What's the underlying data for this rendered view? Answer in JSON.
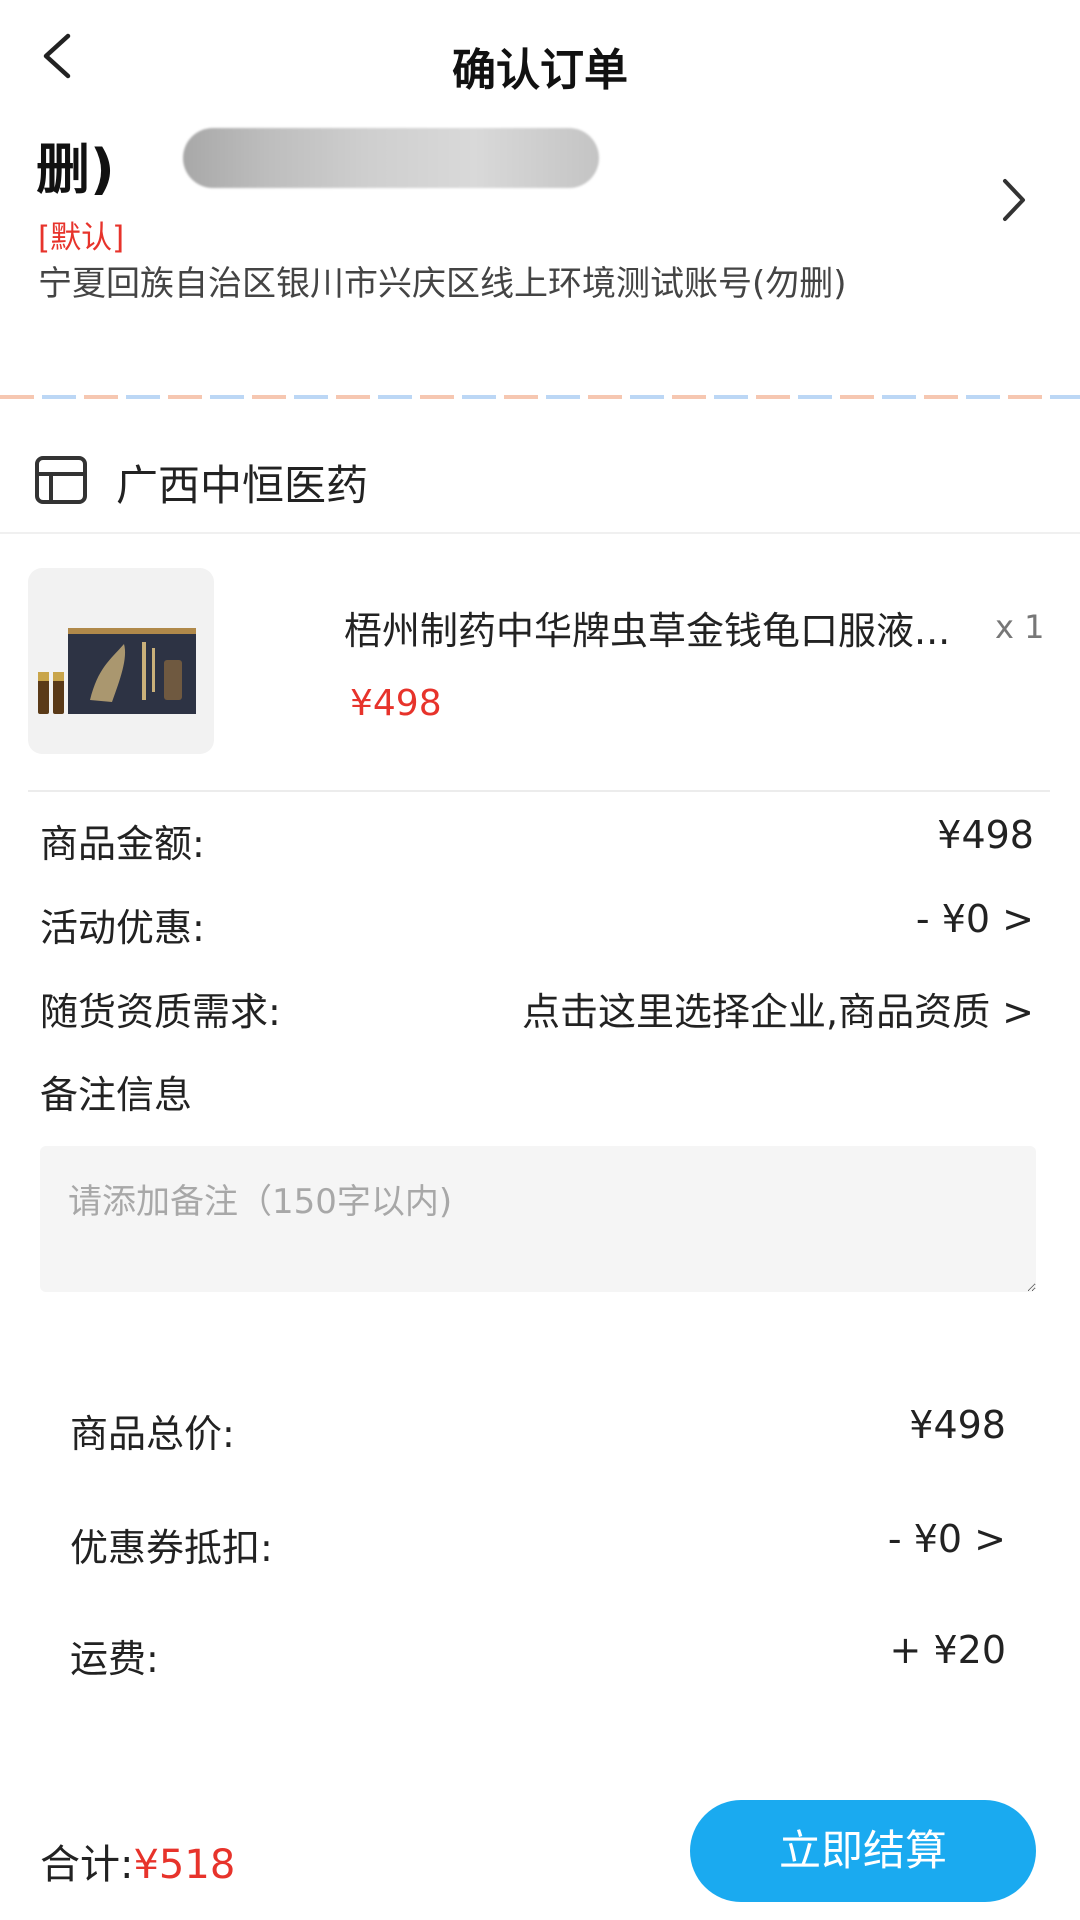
{
  "header": {
    "title": "确认订单"
  },
  "address": {
    "name": "删)",
    "default_tag": "[默认]",
    "text": "宁夏回族自治区银川市兴庆区线上环境测试账号(勿删)"
  },
  "store": {
    "name": "广西中恒医药",
    "icon": "store-icon"
  },
  "product": {
    "name": "梧州制药中华牌虫草金钱龟口服液...",
    "quantity": "x 1",
    "price": "¥498"
  },
  "summary": {
    "goods_amount_label": "商品金额:",
    "goods_amount_value": "¥498",
    "promo_label": "活动优惠:",
    "promo_value": "- ¥0 >",
    "qualification_label": "随货资质需求:",
    "qualification_value": "点击这里选择企业,商品资质 >"
  },
  "remarks": {
    "label": "备注信息",
    "placeholder": "请添加备注（150字以内)"
  },
  "totals": {
    "goods_total_label": "商品总价:",
    "goods_total_value": "¥498",
    "coupon_label": "优惠券抵扣:",
    "coupon_value": "- ¥0 >",
    "shipping_label": "运费:",
    "shipping_value": "+ ¥20"
  },
  "footer": {
    "total_label": "合计:",
    "total_value": "¥518",
    "pay_button": "立即结算"
  },
  "colors": {
    "accent": "#1aaaf0",
    "price": "#e7332b"
  }
}
